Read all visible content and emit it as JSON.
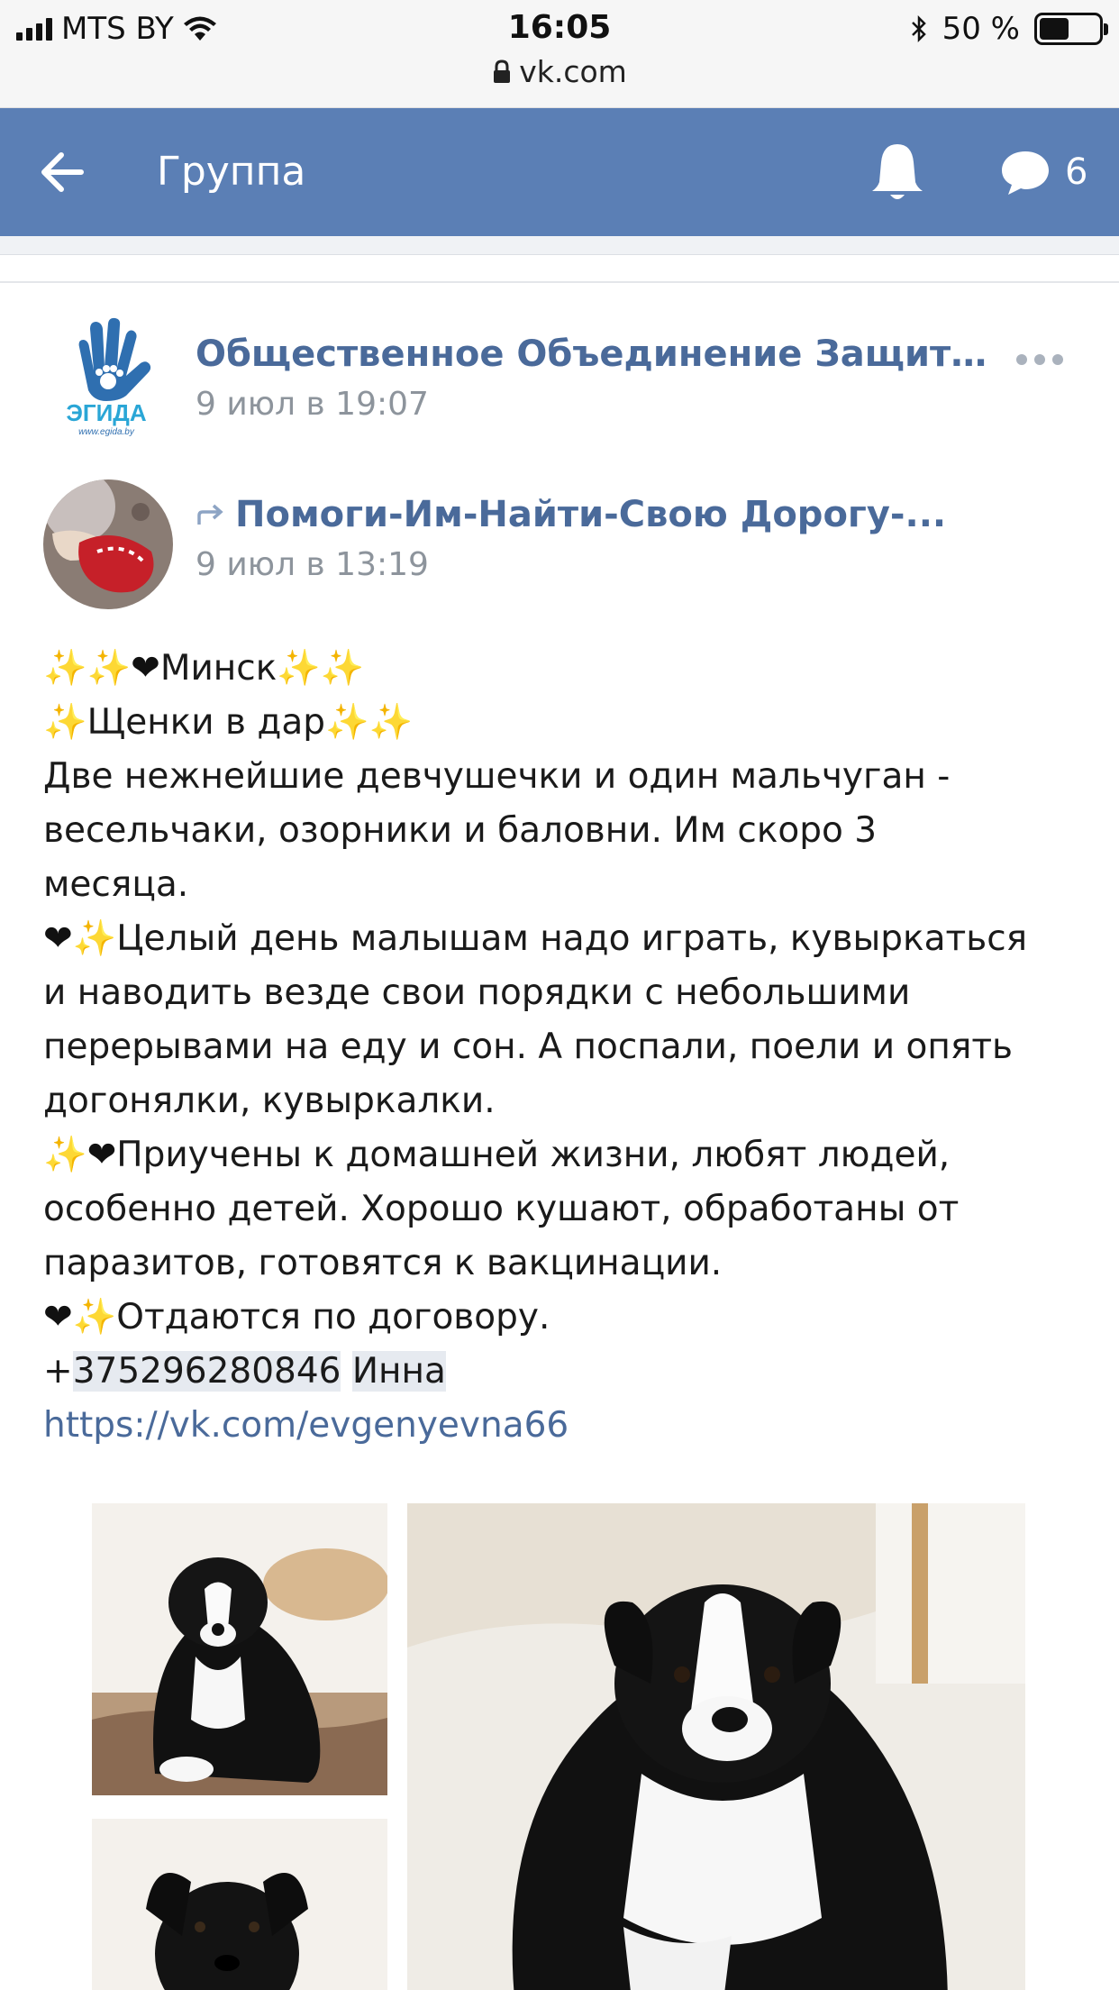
{
  "status_bar": {
    "carrier": "MTS BY",
    "time": "16:05",
    "url": "vk.com",
    "battery": "50 %",
    "battery_level": 0.5
  },
  "header": {
    "title": "Группа",
    "messages_count": "6"
  },
  "post": {
    "group_name": "Общественное Объединение Защит...",
    "group_logo_text": "ЭГИДА",
    "group_logo_url": "www.egida.by",
    "date": "9 июл в 19:07"
  },
  "repost": {
    "name": "Помоги-Им-Найти-Свою Дорогу-...",
    "date": "9 июл в 13:19"
  },
  "body": {
    "line1": "Минск",
    "line2": "Щенки в дар",
    "line3": "Две нежнейшие девчушечки и один мальчуган -",
    "line4": "весельчаки, озорники и баловни. Им скоро 3",
    "line5": "месяца.",
    "line6": "Целый день малышам надо играть, кувыркаться",
    "line7": "и наводить везде свои порядки с небольшими",
    "line8": "перерывами на еду и сон. А поспали, поели и опять",
    "line9": "догонялки, кувыркалки.",
    "line10": "Приучены к домашней жизни, любят людей,",
    "line11": "особенно детей. Хорошо кушают, обработаны от",
    "line12": "паразитов, готовятся к вакцинации.",
    "line13": "Отдаются по договору.",
    "phone_prefix": "+",
    "phone": "375296280846",
    "contact_name": "Инна",
    "link": "https://vk.com/evgenyevna66"
  },
  "icons": {
    "back": "arrow-left-icon",
    "bell": "bell-icon",
    "messages": "chat-bubble-icon",
    "more": "more-dots-icon",
    "repost": "repost-arrow-icon",
    "lock": "lock-icon"
  },
  "colors": {
    "header_bg": "#5b7fb5",
    "link": "#4a6a9a",
    "meta_text": "#8d949c"
  }
}
